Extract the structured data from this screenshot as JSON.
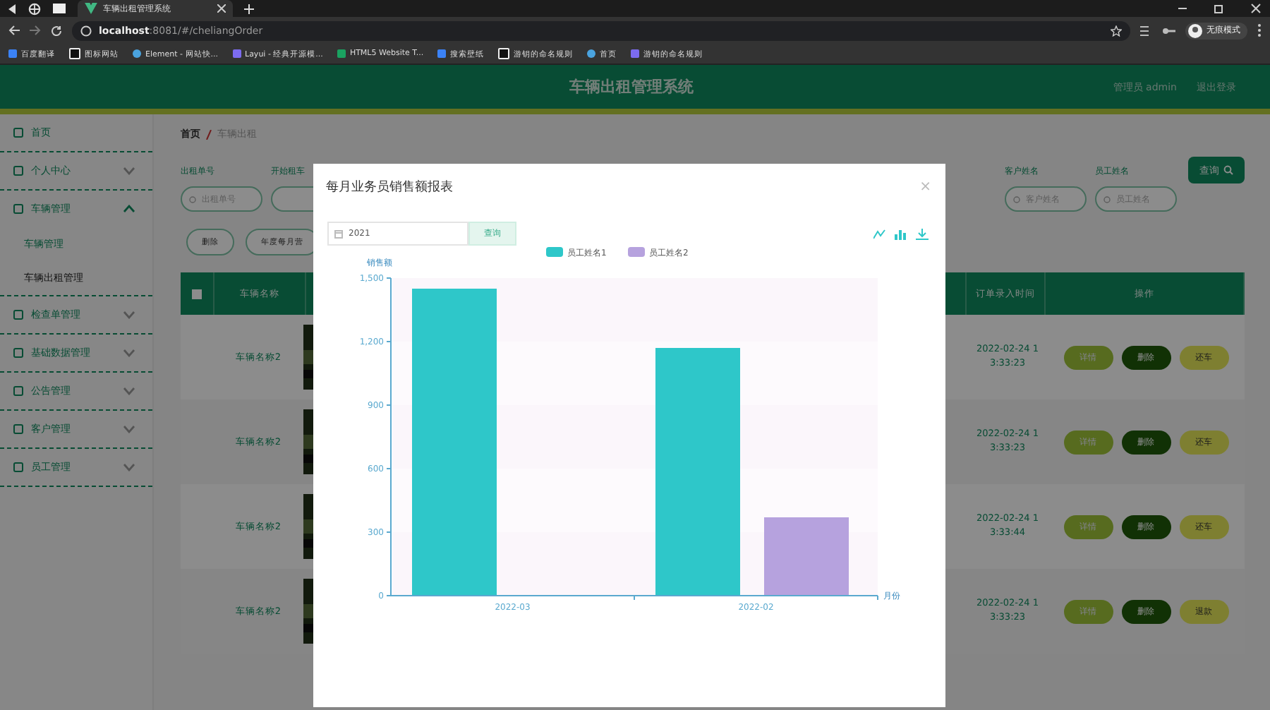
{
  "browser": {
    "tab_title": "车辆出租管理系统",
    "url_host": "localhost",
    "url_rest": ":8081/#/cheliangOrder",
    "profile": "无痕模式",
    "bookmarks": [
      "百度翻译",
      "图标网站",
      "Element - 网站快...",
      "Layui - 经典开源模...",
      "HTML5 Website T...",
      "搜索壁纸",
      "游钥的命名规则",
      "首页",
      "游钥的命名规则"
    ]
  },
  "header": {
    "title": "车辆出租管理系统",
    "user": "管理员 admin",
    "logout": "退出登录"
  },
  "sidebar": {
    "items": [
      {
        "label": "首页"
      },
      {
        "label": "个人中心",
        "expanded": false
      },
      {
        "label": "车辆管理",
        "expanded": true,
        "children": [
          {
            "label": "车辆管理",
            "selected": true
          },
          {
            "label": "车辆出租管理",
            "selected": false
          }
        ]
      },
      {
        "label": "检查单管理",
        "expanded": false
      },
      {
        "label": "基础数据管理",
        "expanded": false
      },
      {
        "label": "公告管理",
        "expanded": false
      },
      {
        "label": "客户管理",
        "expanded": false
      },
      {
        "label": "员工管理",
        "expanded": false
      }
    ]
  },
  "breadcrumb": [
    "首页",
    "车辆出租"
  ],
  "search": {
    "left_fields": [
      {
        "label": "出租单号",
        "placeholder": "出租单号"
      },
      {
        "label": "开始租车"
      }
    ],
    "right_fields": [
      {
        "label": "客户姓名",
        "placeholder": "客户姓名"
      },
      {
        "label": "员工姓名",
        "placeholder": "员工姓名"
      }
    ],
    "button": "查询"
  },
  "actions": [
    "删除",
    "年度每月营"
  ],
  "table": {
    "select_all": {
      "checked": false
    },
    "columns": {
      "name": "车辆名称",
      "time": "订单录入时间",
      "ops": "操作"
    },
    "rows": [
      {
        "name": "车辆名称2",
        "time": "2022-02-24 13:33:23",
        "ops": [
          "详情",
          "删除",
          "还车"
        ]
      },
      {
        "name": "车辆名称2",
        "time": "2022-02-24 13:33:23",
        "ops": [
          "详情",
          "删除",
          "还车"
        ]
      },
      {
        "name": "车辆名称2",
        "time": "2022-02-24 13:33:44",
        "ops": [
          "详情",
          "删除",
          "还车"
        ]
      },
      {
        "name": "车辆名称2",
        "time": "2022-02-24 13:33:23",
        "ops": [
          "详情",
          "删除",
          "退款"
        ]
      }
    ]
  },
  "dialog": {
    "title": "每月业务员销售额报表",
    "close": "×",
    "year": "2021",
    "query": "查询",
    "chart_data": {
      "type": "bar",
      "ylabel": "销售额",
      "xlabel": "月份",
      "legend": "top",
      "categories": [
        "2022-03",
        "2022-02"
      ],
      "series": [
        {
          "name": "员工姓名1",
          "color": "#2ec7c9",
          "values": [
            1450,
            1170
          ]
        },
        {
          "name": "员工姓名2",
          "color": "#b6a2de",
          "values": [
            null,
            370
          ]
        }
      ],
      "ylim": [
        0,
        1500
      ],
      "yticks": [
        0,
        300,
        600,
        900,
        {
          "value": 1200,
          "label": "1,200"
        },
        {
          "value": 1500,
          "label": "1,500"
        }
      ]
    }
  }
}
